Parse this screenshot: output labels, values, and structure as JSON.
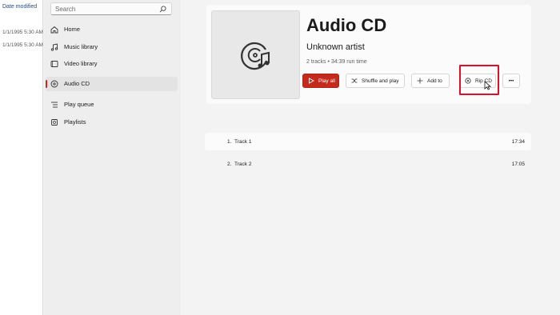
{
  "explorer": {
    "header": "Date modified",
    "rows": [
      "1/1/1995 5:30 AM",
      "1/1/1995 5:30 AM"
    ]
  },
  "sidebar": {
    "search_placeholder": "Search",
    "items": [
      {
        "label": "Home",
        "icon": "home-icon"
      },
      {
        "label": "Music library",
        "icon": "music-note-icon"
      },
      {
        "label": "Video library",
        "icon": "video-icon"
      },
      {
        "label": "Audio CD",
        "icon": "disc-icon",
        "active": true
      },
      {
        "label": "Play queue",
        "icon": "queue-icon"
      },
      {
        "label": "Playlists",
        "icon": "playlist-icon"
      }
    ]
  },
  "album": {
    "title": "Audio CD",
    "artist": "Unknown artist",
    "meta": "2 tracks • 34:39 run time",
    "art_icon": "cd-music-icon"
  },
  "actions": {
    "play_all": "Play all",
    "shuffle": "Shuffle and play",
    "add_to": "Add to",
    "rip_cd": "Rip CD",
    "more": "•••"
  },
  "tracks": [
    {
      "number": "1.",
      "title": "Track 1",
      "duration": "17:34"
    },
    {
      "number": "2.",
      "title": "Track 2",
      "duration": "17:05"
    }
  ],
  "colors": {
    "accent": "#c42b1c",
    "highlight": "#e0102a"
  }
}
